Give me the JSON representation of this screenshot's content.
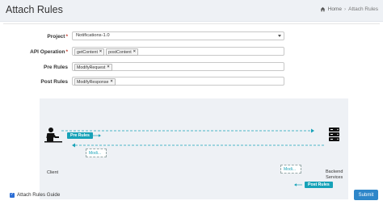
{
  "header": {
    "title": "Attach Rules",
    "breadcrumb": {
      "home": "Home",
      "separator": "›",
      "current": "Attach Rules"
    }
  },
  "form": {
    "project": {
      "label": "Project",
      "required_mark": "*",
      "value": "Notifications-1.0"
    },
    "api_operation": {
      "label": "API Operation",
      "required_mark": "*",
      "tags": [
        "getContent",
        "postContent"
      ]
    },
    "pre_rules": {
      "label": "Pre Rules",
      "tags": [
        "ModifyRequest"
      ]
    },
    "post_rules": {
      "label": "Post Rules",
      "tags": [
        "ModifyResponse"
      ]
    },
    "tag_remove_symbol": "×"
  },
  "diagram": {
    "pre_rules_badge": "Pre Rules",
    "post_rules_badge": "Post Rules",
    "request_module": "Modi...",
    "response_module": "Modi...",
    "client_label": "Client",
    "backend_label_line1": "Backend",
    "backend_label_line2": "Services"
  },
  "footer": {
    "guide_label": "Attach Rules Guide",
    "guide_checked": true,
    "submit_label": "Submit"
  },
  "colors": {
    "accent": "#17a2b8",
    "primary_button": "#2e86c9",
    "checkbox": "#2c6ed5"
  }
}
